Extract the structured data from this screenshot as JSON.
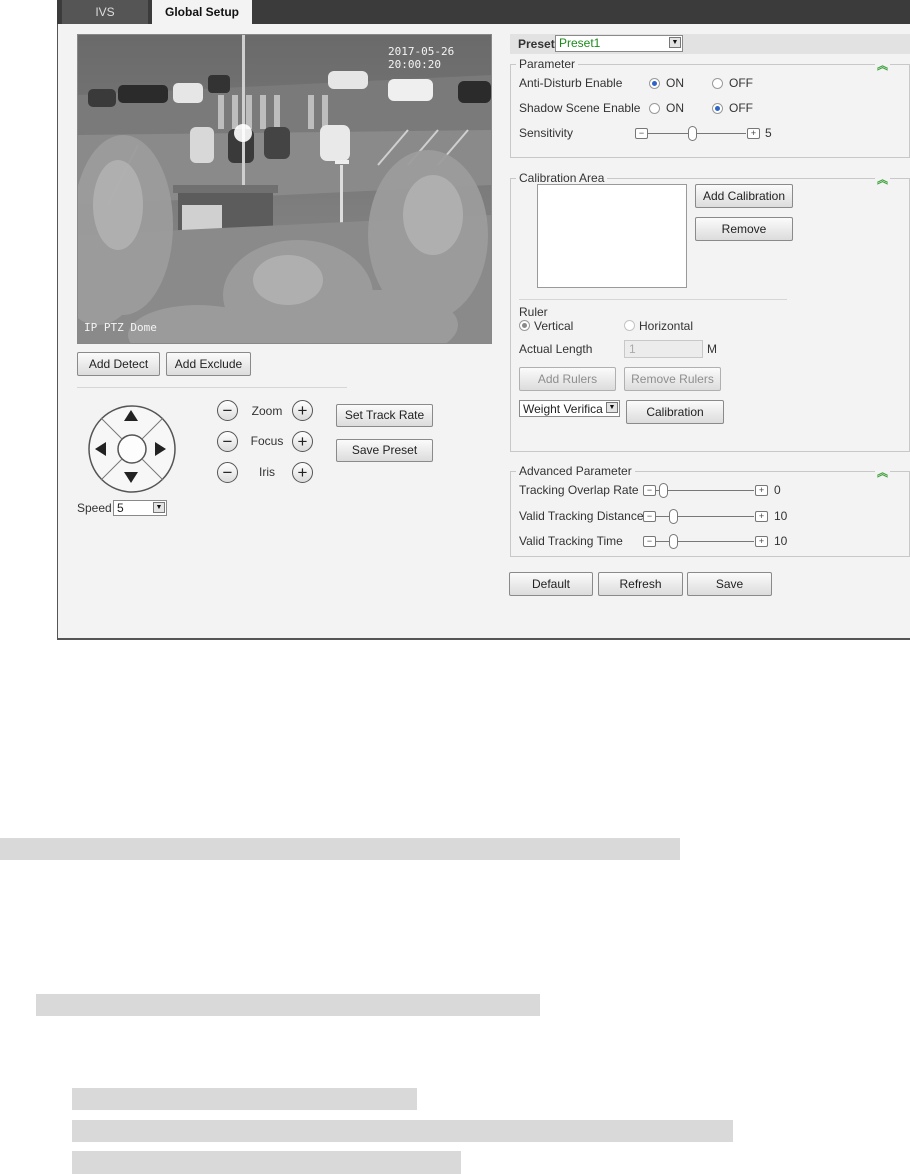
{
  "tabs": [
    {
      "label": "IVS",
      "active": false
    },
    {
      "label": "Global Setup",
      "active": true
    }
  ],
  "video": {
    "timestamp": "2017-05-26 20:00:20",
    "camera_label": "IP PTZ Dome"
  },
  "detect_buttons": {
    "add_detect": "Add Detect",
    "add_exclude": "Add Exclude"
  },
  "ptz": {
    "zoom_label": "Zoom",
    "focus_label": "Focus",
    "iris_label": "Iris",
    "speed_label": "Speed",
    "speed_value": "5",
    "set_track_rate": "Set Track Rate",
    "save_preset": "Save Preset"
  },
  "preset": {
    "label": "Preset",
    "value": "Preset1"
  },
  "parameter": {
    "legend": "Parameter",
    "anti_disturb": {
      "label": "Anti-Disturb Enable",
      "on": "ON",
      "off": "OFF",
      "selected": "ON"
    },
    "shadow_scene": {
      "label": "Shadow Scene Enable",
      "on": "ON",
      "off": "OFF",
      "selected": "OFF"
    },
    "sensitivity": {
      "label": "Sensitivity",
      "value": "5"
    }
  },
  "calibration": {
    "legend": "Calibration Area",
    "add_calibration": "Add Calibration",
    "remove": "Remove",
    "ruler_label": "Ruler",
    "vertical": "Vertical",
    "horizontal": "Horizontal",
    "ruler_selected": "Vertical",
    "actual_length_label": "Actual Length",
    "actual_length_value": "1",
    "unit": "M",
    "add_rulers": "Add Rulers",
    "remove_rulers": "Remove Rulers",
    "mode_value": "Weight Verifica",
    "calibration_button": "Calibration"
  },
  "advanced": {
    "legend": "Advanced Parameter",
    "tracking_overlap_rate": {
      "label": "Tracking Overlap Rate",
      "value": "0"
    },
    "valid_tracking_distance": {
      "label": "Valid Tracking Distance",
      "value": "10"
    },
    "valid_tracking_time": {
      "label": "Valid Tracking Time",
      "value": "10"
    }
  },
  "footer": {
    "default": "Default",
    "refresh": "Refresh",
    "save": "Save"
  },
  "colors": {
    "accent_on": "#2c64c8",
    "collapse_icon": "#3aa03a",
    "preset_text": "#1a8a1a"
  },
  "icons": [
    "up-arrow-icon",
    "down-arrow-icon",
    "left-arrow-icon",
    "right-arrow-icon",
    "minus-icon",
    "plus-icon",
    "collapse-chevron-icon",
    "dropdown-arrow-icon"
  ]
}
